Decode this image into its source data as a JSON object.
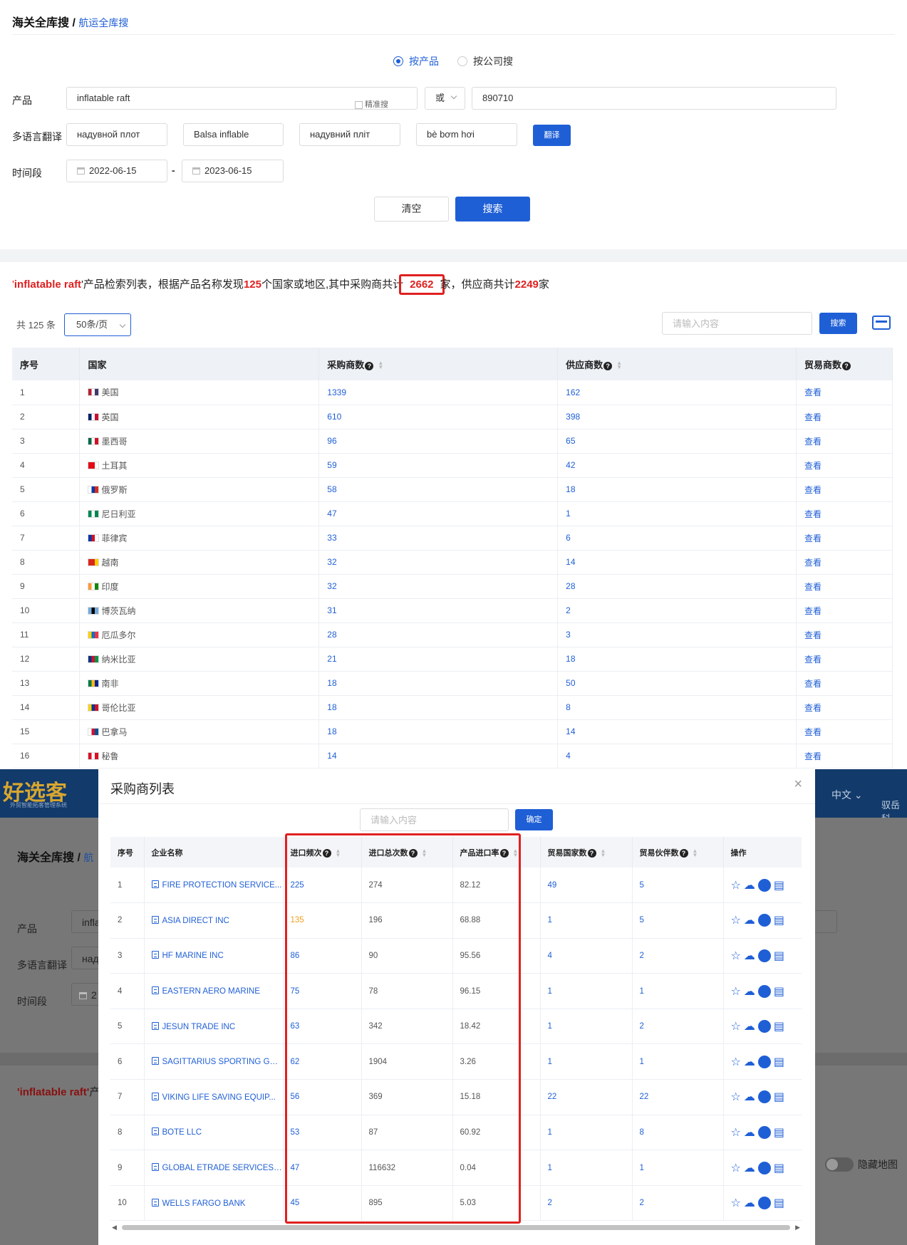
{
  "breadcrumb": {
    "title": "海关全库搜",
    "separator": "/",
    "sub": "航运全库搜"
  },
  "search_mode": {
    "product": "按产品",
    "company": "按公司搜"
  },
  "form": {
    "product_label": "产品",
    "product_value": "inflatable raft",
    "exact_label": "精准搜",
    "logic_value": "或",
    "hs_value": "890710",
    "translate_label": "多语言翻译",
    "translations": [
      "надувной плот",
      "Balsa inflable",
      "надувний пліт",
      "bè bơm hơi"
    ],
    "translate_button": "翻译",
    "period_label": "时间段",
    "date_from": "2022-06-15",
    "date_sep": "-",
    "date_to": "2023-06-15",
    "clear_button": "清空",
    "search_button": "搜索"
  },
  "summary": {
    "quote_open": "'",
    "keyword": "inflatable raft",
    "p1": "'产品检索列表，根据产品名称发现",
    "countries": "125",
    "p2": "个国家或地区,其中采购商共计",
    "buyers": "2662",
    "p3": "家，供应商共计",
    "suppliers": "2249",
    "p4": "家"
  },
  "toolbar": {
    "total": "共 125 条",
    "page_size": "50条/页",
    "search_placeholder": "请输入内容",
    "search_button": "搜索"
  },
  "table": {
    "headers": [
      "序号",
      "国家",
      "采购商数",
      "供应商数",
      "贸易商数"
    ],
    "view_label": "查看",
    "rows": [
      {
        "no": "1",
        "country": "美国",
        "buyers": "1339",
        "suppliers": "162",
        "flag": [
          "#b22234",
          "#ffffff",
          "#3c3b6e"
        ]
      },
      {
        "no": "2",
        "country": "英国",
        "buyers": "610",
        "suppliers": "398",
        "flag": [
          "#012169",
          "#ffffff",
          "#c8102e"
        ]
      },
      {
        "no": "3",
        "country": "墨西哥",
        "buyers": "96",
        "suppliers": "65",
        "flag": [
          "#006847",
          "#ffffff",
          "#ce1126"
        ]
      },
      {
        "no": "4",
        "country": "土耳其",
        "buyers": "59",
        "suppliers": "42",
        "flag": [
          "#e30a17",
          "#e30a17",
          "#ffffff"
        ]
      },
      {
        "no": "5",
        "country": "俄罗斯",
        "buyers": "58",
        "suppliers": "18",
        "flag": [
          "#ffffff",
          "#0039a6",
          "#d52b1e"
        ]
      },
      {
        "no": "6",
        "country": "尼日利亚",
        "buyers": "47",
        "suppliers": "1",
        "flag": [
          "#008751",
          "#ffffff",
          "#008751"
        ]
      },
      {
        "no": "7",
        "country": "菲律宾",
        "buyers": "33",
        "suppliers": "6",
        "flag": [
          "#0038a8",
          "#ce1126",
          "#ffffff"
        ]
      },
      {
        "no": "8",
        "country": "越南",
        "buyers": "32",
        "suppliers": "14",
        "flag": [
          "#da251d",
          "#da251d",
          "#ffcd00"
        ]
      },
      {
        "no": "9",
        "country": "印度",
        "buyers": "32",
        "suppliers": "28",
        "flag": [
          "#ff9933",
          "#ffffff",
          "#138808"
        ]
      },
      {
        "no": "10",
        "country": "博茨瓦纳",
        "buyers": "31",
        "suppliers": "2",
        "flag": [
          "#75aadb",
          "#000000",
          "#75aadb"
        ]
      },
      {
        "no": "11",
        "country": "厄瓜多尔",
        "buyers": "28",
        "suppliers": "3",
        "flag": [
          "#ffd100",
          "#0072ce",
          "#ef3340"
        ]
      },
      {
        "no": "12",
        "country": "纳米比亚",
        "buyers": "21",
        "suppliers": "18",
        "flag": [
          "#003580",
          "#d21034",
          "#009543"
        ]
      },
      {
        "no": "13",
        "country": "南非",
        "buyers": "18",
        "suppliers": "50",
        "flag": [
          "#007a4d",
          "#ffb612",
          "#002395"
        ]
      },
      {
        "no": "14",
        "country": "哥伦比亚",
        "buyers": "18",
        "suppliers": "8",
        "flag": [
          "#fcd116",
          "#003893",
          "#ce1126"
        ]
      },
      {
        "no": "15",
        "country": "巴拿马",
        "buyers": "18",
        "suppliers": "14",
        "flag": [
          "#ffffff",
          "#d21034",
          "#005293"
        ]
      },
      {
        "no": "16",
        "country": "秘鲁",
        "buyers": "14",
        "suppliers": "4",
        "flag": [
          "#d91023",
          "#ffffff",
          "#d91023"
        ]
      }
    ]
  },
  "background_app": {
    "logo": "好选客",
    "logo_sub": "外贸智能拓客管理系统",
    "language": "中文",
    "user_line1": "驭岳科",
    "breadcrumb_title": "海关全库搜",
    "breadcrumb_sub": "航",
    "product_label": "产品",
    "product_partial": "infla",
    "translate_label": "多语言翻译",
    "translate_partial": "надı",
    "period_label": "时间段",
    "period_partial": "2",
    "keyword": "'inflatable raft'",
    "keyword_partial": "产",
    "hide_map": "隐藏地图"
  },
  "modal": {
    "title": "采购商列表",
    "search_placeholder": "请输入内容",
    "confirm_button": "确定",
    "headers": [
      "序号",
      "企业名称",
      "进口频次",
      "进口总次数",
      "产品进口率",
      "贸易国家数",
      "贸易伙伴数",
      "操作"
    ],
    "rows": [
      {
        "no": "1",
        "company": "FIRE PROTECTION SERVICE...",
        "freq": "225",
        "total": "274",
        "rate": "82.12",
        "countries": "49",
        "partners": "5"
      },
      {
        "no": "2",
        "company": "ASIA DIRECT INC",
        "freq": "135",
        "total": "196",
        "rate": "68.88",
        "countries": "1",
        "partners": "5"
      },
      {
        "no": "3",
        "company": "HF MARINE INC",
        "freq": "86",
        "total": "90",
        "rate": "95.56",
        "countries": "4",
        "partners": "2"
      },
      {
        "no": "4",
        "company": "EASTERN AERO MARINE",
        "freq": "75",
        "total": "78",
        "rate": "96.15",
        "countries": "1",
        "partners": "1"
      },
      {
        "no": "5",
        "company": "JESUN TRADE INC",
        "freq": "63",
        "total": "342",
        "rate": "18.42",
        "countries": "1",
        "partners": "2"
      },
      {
        "no": "6",
        "company": "SAGITTARIUS SPORTING GO...",
        "freq": "62",
        "total": "1904",
        "rate": "3.26",
        "countries": "1",
        "partners": "1"
      },
      {
        "no": "7",
        "company": "VIKING LIFE SAVING EQUIP...",
        "freq": "56",
        "total": "369",
        "rate": "15.18",
        "countries": "22",
        "partners": "22"
      },
      {
        "no": "8",
        "company": "BOTE LLC",
        "freq": "53",
        "total": "87",
        "rate": "60.92",
        "countries": "1",
        "partners": "8"
      },
      {
        "no": "9",
        "company": "GLOBAL ETRADE SERVICES ...",
        "freq": "47",
        "total": "116632",
        "rate": "0.04",
        "countries": "1",
        "partners": "1"
      },
      {
        "no": "10",
        "company": "WELLS FARGO BANK",
        "freq": "45",
        "total": "895",
        "rate": "5.03",
        "countries": "2",
        "partners": "2"
      }
    ]
  },
  "colors": {
    "accent": "#1f5fd6",
    "highlight": "#e02020",
    "orange": "#f0a020"
  }
}
